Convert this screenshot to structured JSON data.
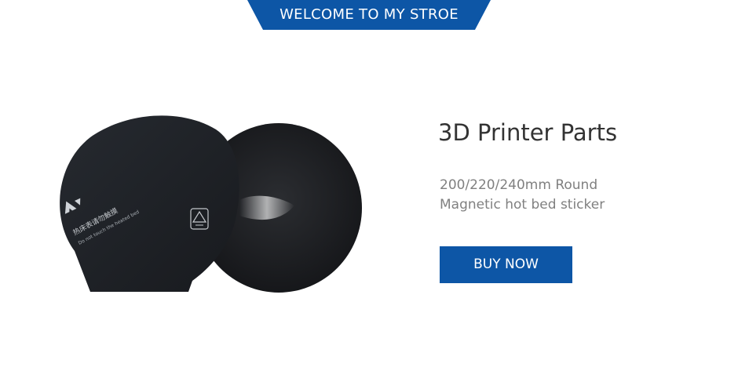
{
  "banner": {
    "text": "WELCOME TO MY STROE",
    "color": "#0d56a6"
  },
  "product": {
    "title": "3D Printer Parts",
    "description_line1": "200/220/240mm Round",
    "description_line2": "Magnetic hot bed sticker",
    "image_label_cn": "热床表请勿触摸",
    "image_label_en": "Do not touch the heated bed"
  },
  "buy_button": {
    "label": "BUY NOW",
    "color": "#0d56a6"
  }
}
